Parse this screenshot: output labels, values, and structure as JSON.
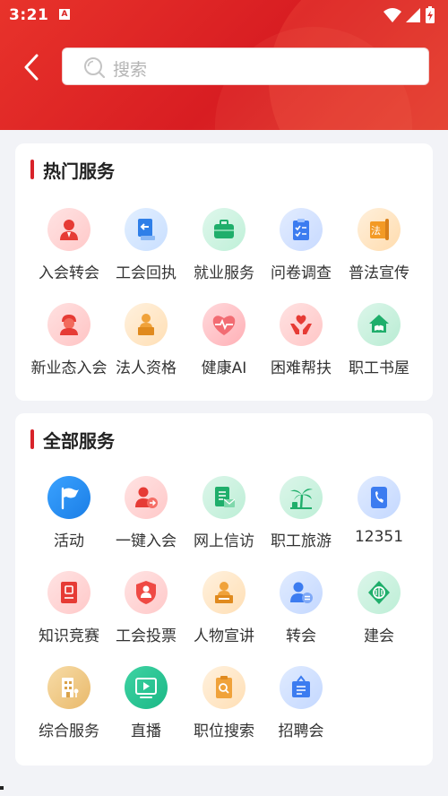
{
  "status_bar": {
    "time": "3:21",
    "notif_glyph": "A"
  },
  "search": {
    "placeholder": "搜索"
  },
  "hot_section": {
    "title": "热门服务",
    "items": [
      {
        "label": "入会转会",
        "icon": "user-transfer-icon"
      },
      {
        "label": "工会回执",
        "icon": "receipt-icon"
      },
      {
        "label": "就业服务",
        "icon": "briefcase-icon"
      },
      {
        "label": "问卷调查",
        "icon": "clipboard-icon"
      },
      {
        "label": "普法宣传",
        "icon": "law-scroll-icon"
      },
      {
        "label": "新业态入会",
        "icon": "courier-icon"
      },
      {
        "label": "法人资格",
        "icon": "podium-person-icon"
      },
      {
        "label": "健康AI",
        "icon": "heart-pulse-icon"
      },
      {
        "label": "困难帮扶",
        "icon": "helping-hands-icon"
      },
      {
        "label": "职工书屋",
        "icon": "book-house-icon"
      }
    ]
  },
  "all_section": {
    "title": "全部服务",
    "items": [
      {
        "label": "活动",
        "icon": "flag-icon"
      },
      {
        "label": "一键入会",
        "icon": "user-login-icon"
      },
      {
        "label": "网上信访",
        "icon": "letter-icon"
      },
      {
        "label": "职工旅游",
        "icon": "palm-tree-icon"
      },
      {
        "label": "12351",
        "icon": "phone-icon"
      },
      {
        "label": "知识竞赛",
        "icon": "quiz-book-icon"
      },
      {
        "label": "工会投票",
        "icon": "vote-shield-icon"
      },
      {
        "label": "人物宣讲",
        "icon": "speaker-person-icon"
      },
      {
        "label": "转会",
        "icon": "user-swap-icon"
      },
      {
        "label": "建会",
        "icon": "union-emblem-icon"
      },
      {
        "label": "综合服务",
        "icon": "building-icon"
      },
      {
        "label": "直播",
        "icon": "live-play-icon"
      },
      {
        "label": "职位搜索",
        "icon": "job-search-icon"
      },
      {
        "label": "招聘会",
        "icon": "recruit-board-icon"
      }
    ]
  },
  "colors": {
    "accent": "#d8232a",
    "header": "#e0302a"
  }
}
